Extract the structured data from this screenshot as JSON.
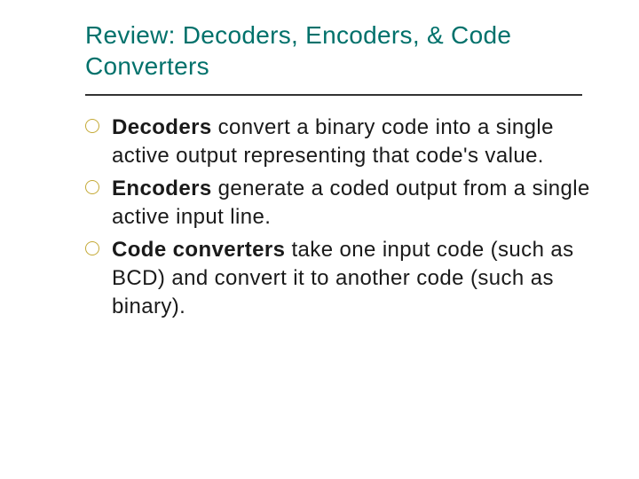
{
  "title": "Review: Decoders, Encoders, & Code Converters",
  "bullets": [
    {
      "bold": "Decoders",
      "rest": " convert a binary code into a single active output representing that code's value."
    },
    {
      "bold": "Encoders",
      "rest": " generate a coded output from a single active input line."
    },
    {
      "bold": "Code converters",
      "rest": " take one input code (such as BCD) and convert it to another code (such as binary)."
    }
  ]
}
